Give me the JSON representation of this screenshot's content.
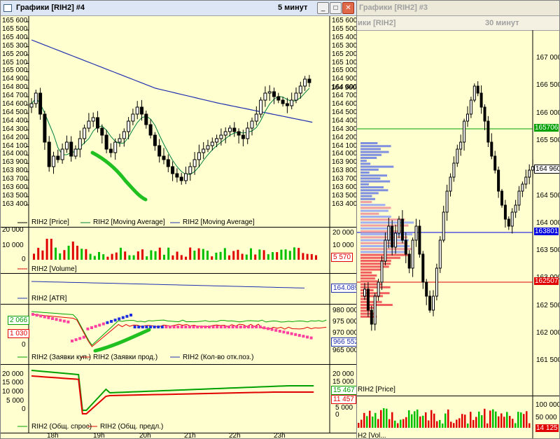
{
  "win1": {
    "title": "Графики [RIH2] #4",
    "timeframe": "5 минут",
    "price_ticks": [
      "165 600",
      "165 500",
      "165 400",
      "165 300",
      "165 200",
      "165 100",
      "165 000",
      "164 900",
      "164 800",
      "164 700",
      "164 600",
      "164 500",
      "164 400",
      "164 300",
      "164 200",
      "164 100",
      "164 000",
      "163 900",
      "163 800",
      "163 700",
      "163 600",
      "163 500",
      "163 400"
    ],
    "price_tag": "164 960",
    "price_legend": [
      "RIH2 [Price]",
      "RIH2 [Moving Average]",
      "RIH2 [Moving Average]"
    ],
    "vol_ticks_left": [
      "20 000",
      "10 000",
      "0"
    ],
    "vol_ticks_right": [
      "20 000",
      "10 000"
    ],
    "vol_tag": "5 570",
    "vol_legend": "RIH2 [Volume]",
    "atr_tag": "164.089",
    "atr_legend": "RIH2 [ATR]",
    "ord_ticks_right": [
      "980 000",
      "975 000",
      "970 000",
      "965 000"
    ],
    "ord_tag_left1": "2 066",
    "ord_tag_left2": "1 030",
    "ord_tag_left3": "0",
    "ord_tag_right": "966 552",
    "ord_legend": [
      "RIH2 (Заявки куп.)",
      "RIH2 (Заявки прод.)",
      "RIH2 (Кол-во отк.поз.)"
    ],
    "dem_ticks_left": [
      "20 000",
      "15 000",
      "10 000",
      "5 000",
      "0"
    ],
    "dem_ticks_right": [
      "20 000",
      "15 000",
      "10 000",
      "5 000",
      "0"
    ],
    "dem_tag1": "15 467",
    "dem_tag2": "11 457",
    "dem_legend": [
      "RIH2 (Общ. спрос)",
      "RIH2 (Общ. предл.)"
    ],
    "time_ticks": [
      "18h",
      "19h",
      "20h",
      "21h",
      "22h",
      "23h"
    ]
  },
  "win2": {
    "title": "Графики [RIH2] #3",
    "sub_title": "ики [RIH2]",
    "timeframe": "30 минут",
    "price_ticks": [
      "167 000",
      "166 500",
      "166 000",
      "165 500",
      "165 000",
      "164 500",
      "164 000",
      "163 500",
      "163 000",
      "162 500",
      "162 000",
      "161 500"
    ],
    "tag_green": "165706",
    "tag_price": "164 960",
    "tag_blue": "163801",
    "tag_red": "162507",
    "price_legend": "RIH2 [Price]",
    "vol_ticks": [
      "100 000",
      "50 000",
      "14 125"
    ],
    "vol_legend": "H2 [Vol..."
  },
  "colors": {
    "bg": "#ffffd0",
    "green": "#00a000",
    "red": "#e00000",
    "blue": "#0000e0",
    "navy": "#2030b0",
    "highlight": "#20c020"
  }
}
